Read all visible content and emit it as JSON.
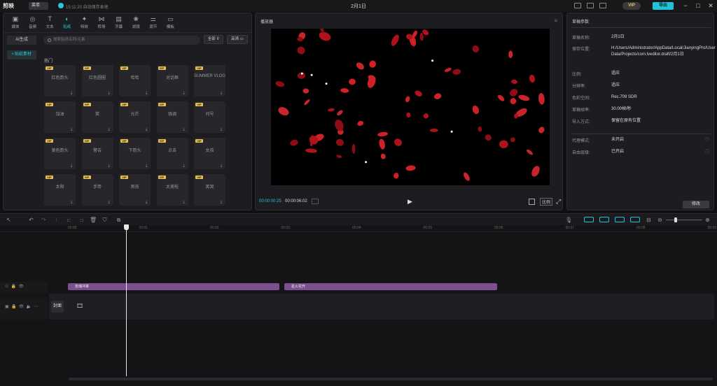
{
  "app": {
    "logo": "剪映",
    "menu": "菜单",
    "save_status": "15:11:20 自动保存本地",
    "project_title": "2月1日",
    "vip": "VIP",
    "export": "导出"
  },
  "tabs": [
    {
      "label": "媒体",
      "icon": "▣"
    },
    {
      "label": "音频",
      "icon": "◎"
    },
    {
      "label": "文本",
      "icon": "T"
    },
    {
      "label": "贴纸",
      "icon": "◐"
    },
    {
      "label": "特效",
      "icon": "✦"
    },
    {
      "label": "转场",
      "icon": "⋈"
    },
    {
      "label": "字幕",
      "icon": "▤"
    },
    {
      "label": "滤镜",
      "icon": "❀"
    },
    {
      "label": "调节",
      "icon": "⚌"
    },
    {
      "label": "模板",
      "icon": "▭"
    }
  ],
  "sidebar": {
    "ai": "AI生成",
    "stickers": "• 贴纸素材"
  },
  "search": {
    "placeholder": "搜索贴纸名称/元素"
  },
  "filters": {
    "all": "全部",
    "clean": "高清"
  },
  "hot_label": "热门",
  "stickers": [
    {
      "name": "红色箭头"
    },
    {
      "name": "红色圆圈"
    },
    {
      "name": "哈哈"
    },
    {
      "name": "对话框"
    },
    {
      "name": "SUMMER VLOG"
    },
    {
      "name": "加油"
    },
    {
      "name": "笑"
    },
    {
      "name": "光芒"
    },
    {
      "name": "强调"
    },
    {
      "name": "问号"
    },
    {
      "name": "黄色箭头"
    },
    {
      "name": "警告"
    },
    {
      "name": "下箭头"
    },
    {
      "name": "点击"
    },
    {
      "name": "女孩"
    },
    {
      "name": "太阳"
    },
    {
      "name": "手势"
    },
    {
      "name": "男孩"
    },
    {
      "name": "太美啦"
    },
    {
      "name": "笑哭"
    }
  ],
  "player": {
    "title": "播放器",
    "time_current": "00:00:00:25",
    "time_total": "00:00:06:02",
    "play_icon": "▶",
    "ratio": "比例"
  },
  "props": {
    "title": "草稿参数",
    "rows": [
      {
        "label": "草稿名称:",
        "value": "2月1日"
      },
      {
        "label": "保存位置:",
        "value": "H:/Users/Administrator/AppData/Local/JianyingPro/User Data/Projects/com.lveditor.draft/2月1日"
      },
      {
        "label": "比例:",
        "value": "适应"
      },
      {
        "label": "分辨率:",
        "value": "适应"
      },
      {
        "label": "色彩空间:",
        "value": "Rec.709 SDR"
      },
      {
        "label": "草稿帧率:",
        "value": "30.00帧/秒"
      },
      {
        "label": "导入方式:",
        "value": "保留在原有位置"
      },
      {
        "label": "代理模式:",
        "value": "未开启"
      },
      {
        "label": "自由层级:",
        "value": "已开启"
      }
    ],
    "modify": "修改"
  },
  "ruler": [
    "00:00",
    "00:01",
    "00:02",
    "00:03",
    "00:04",
    "00:05",
    "00:06",
    "00:07",
    "00:08",
    "00:09"
  ],
  "clips": [
    {
      "label": "玫瑰冲掌"
    },
    {
      "label": "星火花开"
    }
  ],
  "cover": "封面"
}
